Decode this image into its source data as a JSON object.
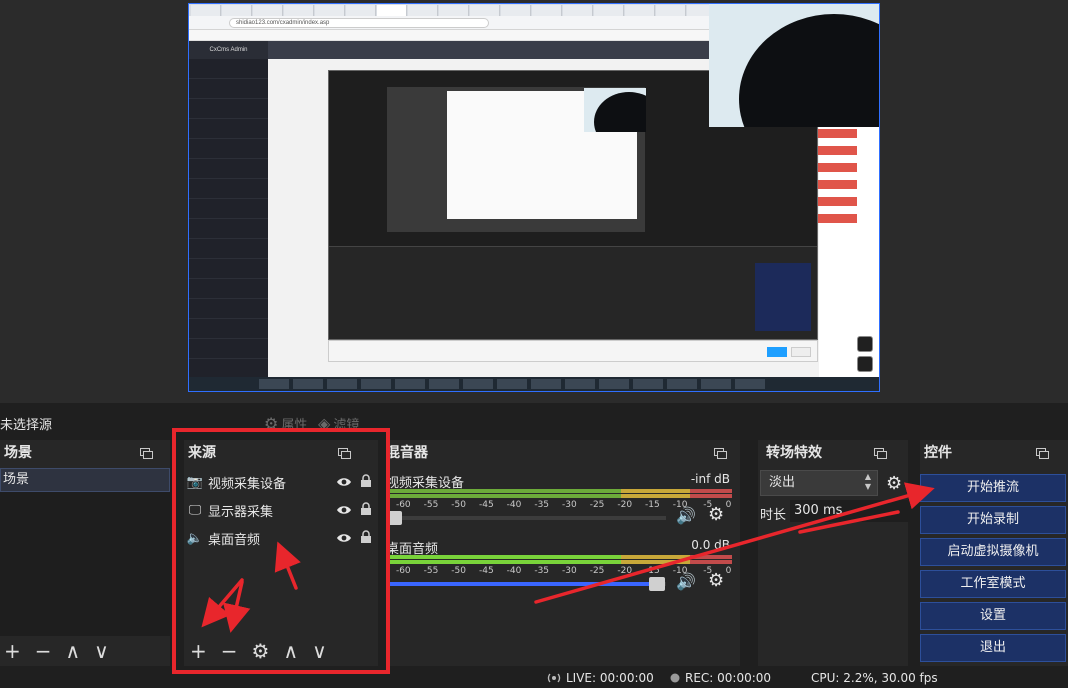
{
  "preview": {
    "browser_url": "shidiao123.com/cxadmin/index.asp",
    "admin_brand": "CxCms Admin"
  },
  "toolbar": {
    "no_source_label": "未选择源",
    "properties_label": "属性",
    "filters_label": "滤镜"
  },
  "scenes": {
    "title": "场景",
    "items": [
      "场景"
    ],
    "controls": [
      "+",
      "−",
      "∧",
      "∨"
    ]
  },
  "sources": {
    "title": "来源",
    "items": [
      {
        "label": "视频采集设备",
        "icon": "camera-icon"
      },
      {
        "label": "显示器采集",
        "icon": "monitor-icon"
      },
      {
        "label": "桌面音频",
        "icon": "speaker-icon"
      }
    ],
    "controls": [
      "+",
      "−",
      "⚙",
      "∧",
      "∨"
    ]
  },
  "mixer": {
    "title": "混音器",
    "scale": [
      "-60",
      "-55",
      "-50",
      "-45",
      "-40",
      "-35",
      "-30",
      "-25",
      "-20",
      "-15",
      "-10",
      "-5",
      "0"
    ],
    "channels": [
      {
        "name": "视频采集设备",
        "db": "-inf dB",
        "volume": 0.0
      },
      {
        "name": "桌面音频",
        "db": "0.0 dB",
        "volume": 1.0
      }
    ]
  },
  "transitions": {
    "title": "转场特效",
    "selected": "淡出",
    "duration_label": "时长",
    "duration_value": "300 ms"
  },
  "controls": {
    "title": "控件",
    "buttons": [
      "开始推流",
      "开始录制",
      "启动虚拟摄像机",
      "工作室模式",
      "设置",
      "退出"
    ]
  },
  "status": {
    "live": "LIVE: 00:00:00",
    "rec": "REC: 00:00:00",
    "cpu": "CPU: 2.2%, 30.00 fps"
  },
  "colors": {
    "annotation_red": "#e8262c",
    "control_button_bg": "#1c3166",
    "accent_blue": "#3a66ff"
  }
}
